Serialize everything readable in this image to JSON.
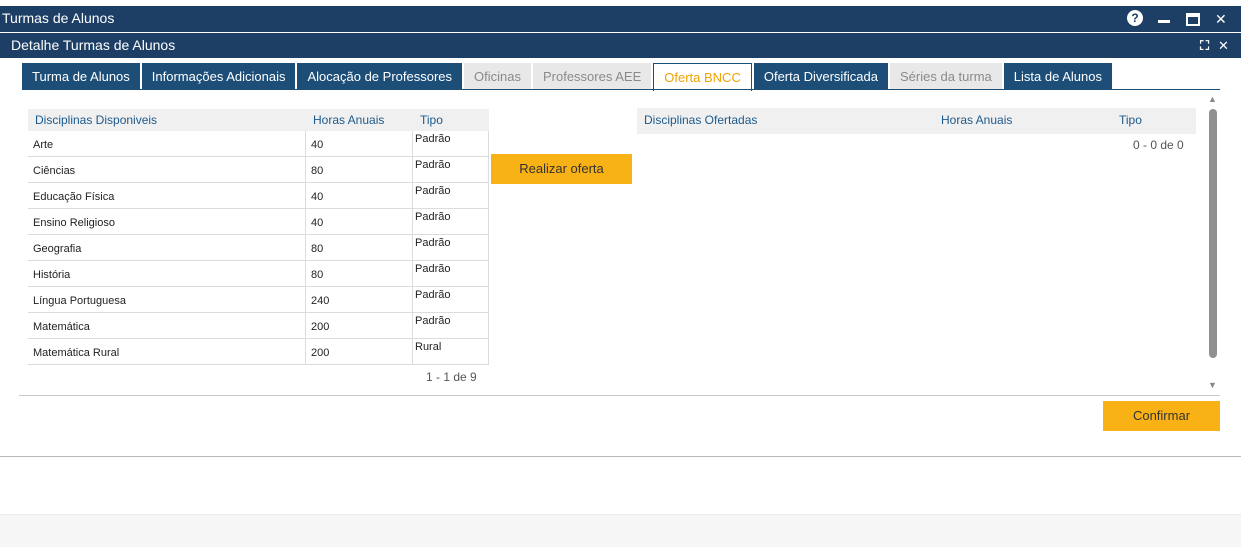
{
  "window": {
    "title": "Turmas de Alunos",
    "help_glyph": "?",
    "close_glyph": "✕"
  },
  "panel": {
    "title": "Detalhe Turmas de Alunos",
    "expand_glyph": "⛶",
    "close_glyph": "✕"
  },
  "tabs": [
    {
      "label": "Turma de Alunos",
      "state": "normal"
    },
    {
      "label": "Informações Adicionais",
      "state": "normal"
    },
    {
      "label": "Alocação de Professores",
      "state": "normal"
    },
    {
      "label": "Oficinas",
      "state": "disabled"
    },
    {
      "label": "Professores AEE",
      "state": "disabled"
    },
    {
      "label": "Oferta BNCC",
      "state": "active"
    },
    {
      "label": "Oferta Diversificada",
      "state": "normal"
    },
    {
      "label": "Séries da turma",
      "state": "disabled"
    },
    {
      "label": "Lista de Alunos",
      "state": "normal"
    }
  ],
  "available": {
    "headers": {
      "name": "Disciplinas Disponiveis",
      "hours": "Horas Anuais",
      "type": "Tipo"
    },
    "rows": [
      {
        "name": "Arte",
        "hours": "40",
        "type": "Padrão"
      },
      {
        "name": "Ciências",
        "hours": "80",
        "type": "Padrão"
      },
      {
        "name": "Educação Física",
        "hours": "40",
        "type": "Padrão"
      },
      {
        "name": "Ensino Religioso",
        "hours": "40",
        "type": "Padrão"
      },
      {
        "name": "Geografia",
        "hours": "80",
        "type": "Padrão"
      },
      {
        "name": "História",
        "hours": "80",
        "type": "Padrão"
      },
      {
        "name": "Língua Portuguesa",
        "hours": "240",
        "type": "Padrão"
      },
      {
        "name": "Matemática",
        "hours": "200",
        "type": "Padrão"
      },
      {
        "name": "Matemática Rural",
        "hours": "200",
        "type": "Rural"
      }
    ],
    "pager": "1 - 1 de 9"
  },
  "offer_button": "Realizar oferta",
  "offered": {
    "headers": {
      "name": "Disciplinas Ofertadas",
      "hours": "Horas Anuais",
      "type": "Tipo"
    },
    "pager": "0 - 0 de 0"
  },
  "confirm_button": "Confirmar",
  "colors": {
    "header_bg": "#1d3f66",
    "tab_bg": "#1d4e78",
    "accent": "#f9b215",
    "active_tab_text": "#f0a300"
  }
}
